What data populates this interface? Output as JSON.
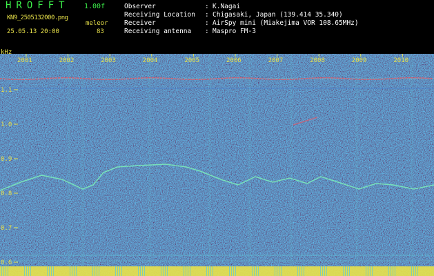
{
  "header": {
    "app_title": "HROFFT",
    "version": "1.00f",
    "filename": "KN9_2505132000.png",
    "mode_label": "meleor",
    "datetime": "25.05.13 20:00",
    "mode_value": "83",
    "meta": [
      {
        "label": "Observer",
        "value": "K.Nagai"
      },
      {
        "label": "Receiving Location",
        "value": "Chigasaki, Japan (139.414 35.340)"
      },
      {
        "label": "Receiver",
        "value": "AirSpy mini (Miakejima VOR 108.65MHz)"
      },
      {
        "label": "Receiving antenna",
        "value": "Maspro FM-3"
      }
    ]
  },
  "spectrogram": {
    "y_unit": "kHz",
    "y_ticks": [
      "1.1",
      "1.0",
      "0.9",
      "0.8",
      "0.7",
      "0.6"
    ],
    "x_ticks": [
      "2001",
      "2002",
      "2003",
      "2004",
      "2005",
      "2006",
      "2007",
      "2008",
      "2009",
      "2010"
    ],
    "colors": {
      "background": "#1a3aa8",
      "noise_dark": "#0f2a8c",
      "noise_light": "#3d7ad8",
      "noise_cyan": "#5fc8d8",
      "trace": "#7cf0b8",
      "carrier": "#e05a6a",
      "text": "#e9e24a",
      "header_green": "#3cf04a"
    }
  }
}
